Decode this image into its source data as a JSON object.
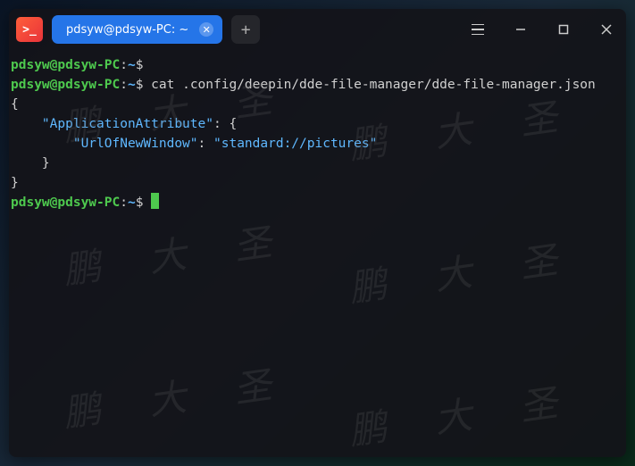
{
  "titlebar": {
    "tab_title": "pdsyw@pdsyw-PC: ~"
  },
  "prompt": {
    "user": "pdsyw",
    "at": "@",
    "host": "pdsyw-PC",
    "colon": ":",
    "path": "~",
    "dollar": "$"
  },
  "lines": {
    "l1_cmd": "",
    "l2_cmd": " cat .config/deepin/dde-file-manager/dde-file-manager.json",
    "json_l1": "{",
    "json_l2_indent": "    ",
    "json_l2_key": "\"ApplicationAttribute\"",
    "json_l2_after": ": {",
    "json_l3_indent": "        ",
    "json_l3_key": "\"UrlOfNewWindow\"",
    "json_l3_mid": ": ",
    "json_l3_val": "\"standard://pictures\"",
    "json_l4": "    }",
    "json_l5": "}"
  },
  "watermark": "鹏 大 圣"
}
